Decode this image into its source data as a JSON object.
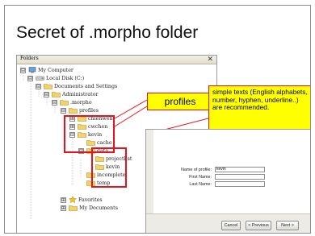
{
  "slide": {
    "title": "Secret of .morpho folder"
  },
  "folders_panel": {
    "header": "Folders",
    "close_glyph": "✕",
    "tree": [
      {
        "label": "My Computer",
        "icon": "computer-icon",
        "expander": "⊟"
      },
      {
        "label": "Local Disk (C:)",
        "icon": "drive-icon",
        "expander": "⊟"
      },
      {
        "label": "Documents and Settings",
        "icon": "folder-icon",
        "expander": "⊟"
      },
      {
        "label": "Administrator",
        "icon": "folder-icon",
        "expander": "⊟"
      },
      {
        "label": ".morpho",
        "icon": "folder-icon",
        "expander": "⊟"
      },
      {
        "label": "profiles",
        "icon": "folder-icon",
        "expander": "⊟"
      },
      {
        "label": "chienwen",
        "icon": "folder-icon",
        "expander": "⊞"
      },
      {
        "label": "cwchen",
        "icon": "folder-icon",
        "expander": "⊞"
      },
      {
        "label": "kevin",
        "icon": "folder-icon",
        "expander": "⊟"
      },
      {
        "label": "cache",
        "icon": "folder-icon",
        "expander": ""
      },
      {
        "label": "data",
        "icon": "folder-icon",
        "expander": "⊟"
      },
      {
        "label": "projectlist",
        "icon": "folder-icon",
        "expander": ""
      },
      {
        "label": "kevin",
        "icon": "folder-icon",
        "expander": ""
      },
      {
        "label": "incomplete",
        "icon": "folder-icon",
        "expander": ""
      },
      {
        "label": "temp",
        "icon": "folder-icon",
        "expander": ""
      },
      {
        "label": "Favorites",
        "icon": "star-icon",
        "expander": "⊞"
      },
      {
        "label": "My Documents",
        "icon": "folder-icon",
        "expander": "⊞"
      }
    ]
  },
  "callouts": {
    "profiles": "profiles",
    "note": "simple texts (English alphabets, number, hyphen, underline..) are recommended."
  },
  "dialog": {
    "fields": [
      {
        "label": "Name of profile:",
        "value": "kevin"
      },
      {
        "label": "First Name:",
        "value": ""
      },
      {
        "label": "Last Name:",
        "value": ""
      }
    ],
    "buttons": {
      "cancel": "Cancel",
      "previous": "< Previous",
      "next": "Next >"
    }
  },
  "colors": {
    "highlight": "#e8121b",
    "callout_fill": "#ffff00",
    "folder": "#f2d36a"
  }
}
